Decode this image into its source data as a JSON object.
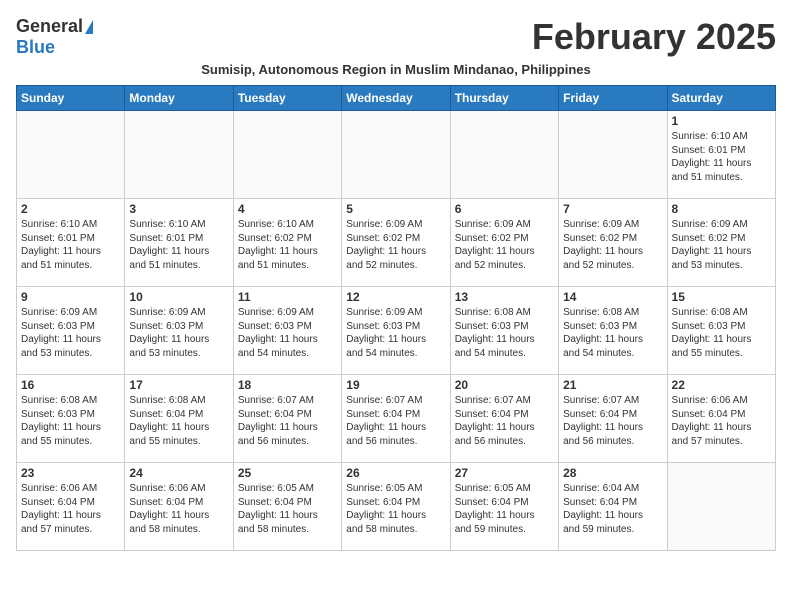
{
  "header": {
    "logo_general": "General",
    "logo_blue": "Blue",
    "month_title": "February 2025",
    "subtitle": "Sumisip, Autonomous Region in Muslim Mindanao, Philippines"
  },
  "days_of_week": [
    "Sunday",
    "Monday",
    "Tuesday",
    "Wednesday",
    "Thursday",
    "Friday",
    "Saturday"
  ],
  "weeks": [
    [
      {
        "day": "",
        "info": ""
      },
      {
        "day": "",
        "info": ""
      },
      {
        "day": "",
        "info": ""
      },
      {
        "day": "",
        "info": ""
      },
      {
        "day": "",
        "info": ""
      },
      {
        "day": "",
        "info": ""
      },
      {
        "day": "1",
        "info": "Sunrise: 6:10 AM\nSunset: 6:01 PM\nDaylight: 11 hours\nand 51 minutes."
      }
    ],
    [
      {
        "day": "2",
        "info": "Sunrise: 6:10 AM\nSunset: 6:01 PM\nDaylight: 11 hours\nand 51 minutes."
      },
      {
        "day": "3",
        "info": "Sunrise: 6:10 AM\nSunset: 6:01 PM\nDaylight: 11 hours\nand 51 minutes."
      },
      {
        "day": "4",
        "info": "Sunrise: 6:10 AM\nSunset: 6:02 PM\nDaylight: 11 hours\nand 51 minutes."
      },
      {
        "day": "5",
        "info": "Sunrise: 6:09 AM\nSunset: 6:02 PM\nDaylight: 11 hours\nand 52 minutes."
      },
      {
        "day": "6",
        "info": "Sunrise: 6:09 AM\nSunset: 6:02 PM\nDaylight: 11 hours\nand 52 minutes."
      },
      {
        "day": "7",
        "info": "Sunrise: 6:09 AM\nSunset: 6:02 PM\nDaylight: 11 hours\nand 52 minutes."
      },
      {
        "day": "8",
        "info": "Sunrise: 6:09 AM\nSunset: 6:02 PM\nDaylight: 11 hours\nand 53 minutes."
      }
    ],
    [
      {
        "day": "9",
        "info": "Sunrise: 6:09 AM\nSunset: 6:03 PM\nDaylight: 11 hours\nand 53 minutes."
      },
      {
        "day": "10",
        "info": "Sunrise: 6:09 AM\nSunset: 6:03 PM\nDaylight: 11 hours\nand 53 minutes."
      },
      {
        "day": "11",
        "info": "Sunrise: 6:09 AM\nSunset: 6:03 PM\nDaylight: 11 hours\nand 54 minutes."
      },
      {
        "day": "12",
        "info": "Sunrise: 6:09 AM\nSunset: 6:03 PM\nDaylight: 11 hours\nand 54 minutes."
      },
      {
        "day": "13",
        "info": "Sunrise: 6:08 AM\nSunset: 6:03 PM\nDaylight: 11 hours\nand 54 minutes."
      },
      {
        "day": "14",
        "info": "Sunrise: 6:08 AM\nSunset: 6:03 PM\nDaylight: 11 hours\nand 54 minutes."
      },
      {
        "day": "15",
        "info": "Sunrise: 6:08 AM\nSunset: 6:03 PM\nDaylight: 11 hours\nand 55 minutes."
      }
    ],
    [
      {
        "day": "16",
        "info": "Sunrise: 6:08 AM\nSunset: 6:03 PM\nDaylight: 11 hours\nand 55 minutes."
      },
      {
        "day": "17",
        "info": "Sunrise: 6:08 AM\nSunset: 6:04 PM\nDaylight: 11 hours\nand 55 minutes."
      },
      {
        "day": "18",
        "info": "Sunrise: 6:07 AM\nSunset: 6:04 PM\nDaylight: 11 hours\nand 56 minutes."
      },
      {
        "day": "19",
        "info": "Sunrise: 6:07 AM\nSunset: 6:04 PM\nDaylight: 11 hours\nand 56 minutes."
      },
      {
        "day": "20",
        "info": "Sunrise: 6:07 AM\nSunset: 6:04 PM\nDaylight: 11 hours\nand 56 minutes."
      },
      {
        "day": "21",
        "info": "Sunrise: 6:07 AM\nSunset: 6:04 PM\nDaylight: 11 hours\nand 56 minutes."
      },
      {
        "day": "22",
        "info": "Sunrise: 6:06 AM\nSunset: 6:04 PM\nDaylight: 11 hours\nand 57 minutes."
      }
    ],
    [
      {
        "day": "23",
        "info": "Sunrise: 6:06 AM\nSunset: 6:04 PM\nDaylight: 11 hours\nand 57 minutes."
      },
      {
        "day": "24",
        "info": "Sunrise: 6:06 AM\nSunset: 6:04 PM\nDaylight: 11 hours\nand 58 minutes."
      },
      {
        "day": "25",
        "info": "Sunrise: 6:05 AM\nSunset: 6:04 PM\nDaylight: 11 hours\nand 58 minutes."
      },
      {
        "day": "26",
        "info": "Sunrise: 6:05 AM\nSunset: 6:04 PM\nDaylight: 11 hours\nand 58 minutes."
      },
      {
        "day": "27",
        "info": "Sunrise: 6:05 AM\nSunset: 6:04 PM\nDaylight: 11 hours\nand 59 minutes."
      },
      {
        "day": "28",
        "info": "Sunrise: 6:04 AM\nSunset: 6:04 PM\nDaylight: 11 hours\nand 59 minutes."
      },
      {
        "day": "",
        "info": ""
      }
    ]
  ]
}
